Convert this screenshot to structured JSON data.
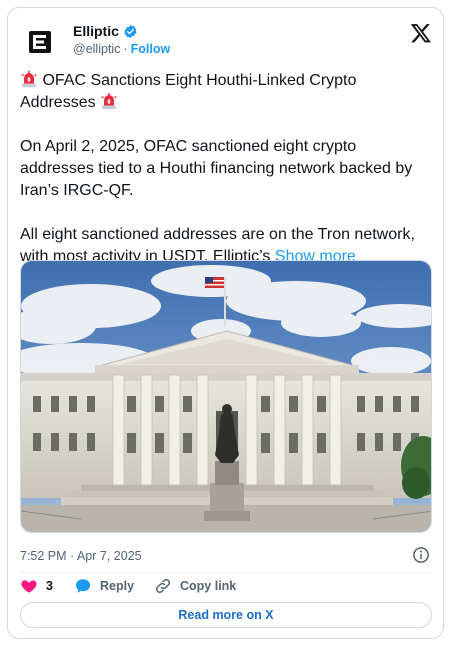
{
  "author": {
    "display_name": "Elliptic",
    "handle": "@elliptic",
    "separator": "·",
    "follow_label": "Follow"
  },
  "tweet": {
    "line1": "OFAC Sanctions Eight Houthi-Linked Crypto",
    "line2": "Addresses",
    "para2": "On April 2, 2025, OFAC sanctioned eight crypto\naddresses tied to a Houthi financing network backed by\nIran’s IRGC-QF.",
    "para3": "All eight sanctioned addresses are on the Tron network,\nwith most activity in USDT. Elliptic’s",
    "show_more": "Show more"
  },
  "timestamp": "7:52 PM · Apr 7, 2025",
  "actions": {
    "like_count": "3",
    "reply_label": "Reply",
    "copy_link_label": "Copy link"
  },
  "read_more_label": "Read more on X",
  "colors": {
    "accent": "#1d9bf0",
    "like": "#f91880",
    "text": "#0f1419",
    "muted": "#536471",
    "border": "#cfd9de"
  },
  "icons": [
    "verified-badge-icon",
    "x-logo-icon",
    "siren-icon",
    "info-icon",
    "heart-icon",
    "reply-icon",
    "link-icon"
  ]
}
